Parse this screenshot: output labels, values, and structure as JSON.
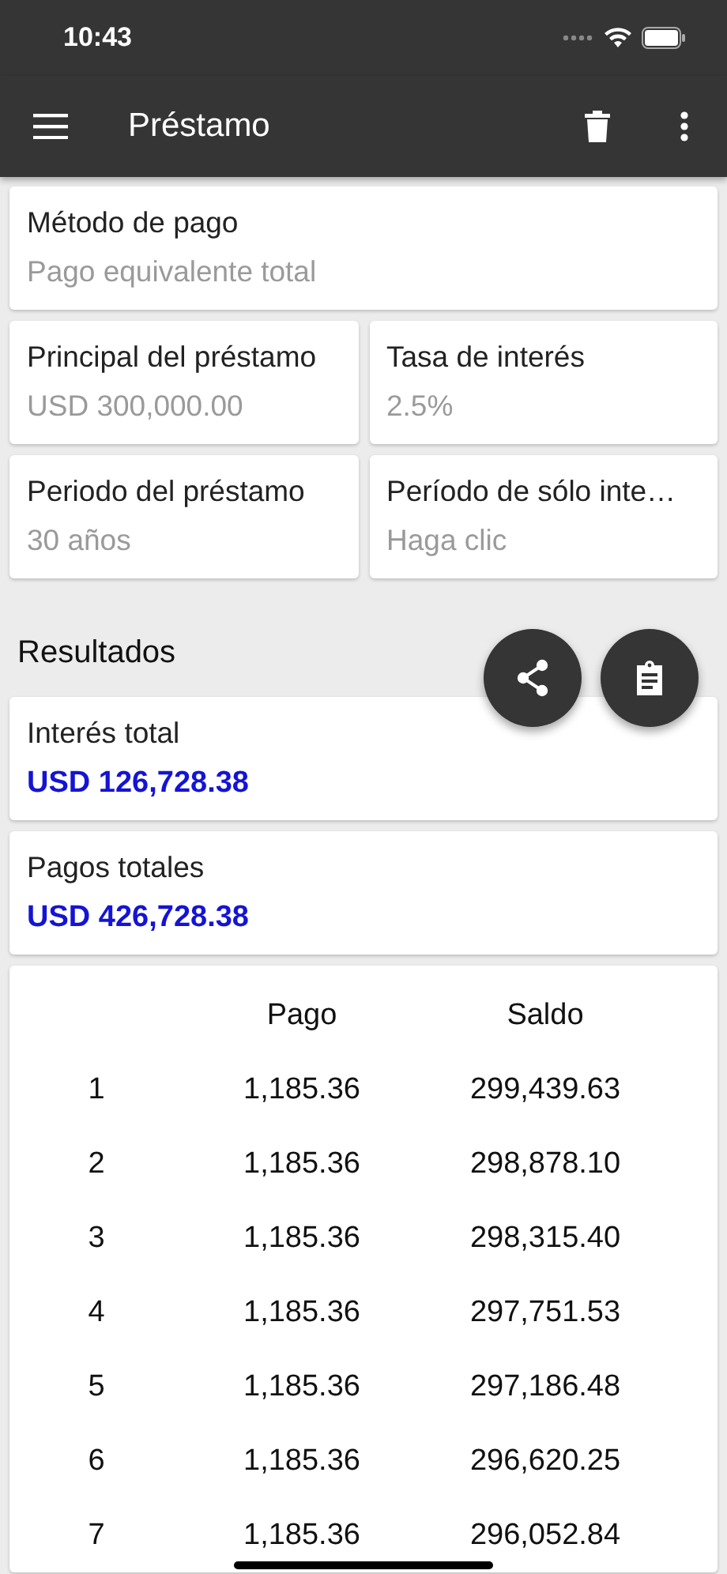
{
  "status_bar": {
    "time": "10:43"
  },
  "app_bar": {
    "title": "Préstamo"
  },
  "inputs": [
    {
      "label": "Método de pago",
      "value": "Pago equivalente total",
      "wide": true
    },
    {
      "label": "Principal del préstamo",
      "value": "USD 300,000.00",
      "wide": false
    },
    {
      "label": "Tasa de interés",
      "value": "2.5%",
      "wide": false
    },
    {
      "label": "Periodo del préstamo",
      "value": "30 años",
      "wide": false
    },
    {
      "label": "Período de sólo inte…",
      "value": "Haga clic",
      "wide": false
    }
  ],
  "results": {
    "title": "Resultados",
    "items": [
      {
        "label": "Interés total",
        "value": "USD 126,728.38"
      },
      {
        "label": "Pagos totales",
        "value": "USD 426,728.38"
      }
    ]
  },
  "table": {
    "columns": [
      "",
      "Pago",
      "Saldo"
    ],
    "rows": [
      [
        "1",
        "1,185.36",
        "299,439.63"
      ],
      [
        "2",
        "1,185.36",
        "298,878.10"
      ],
      [
        "3",
        "1,185.36",
        "298,315.40"
      ],
      [
        "4",
        "1,185.36",
        "297,751.53"
      ],
      [
        "5",
        "1,185.36",
        "297,186.48"
      ],
      [
        "6",
        "1,185.36",
        "296,620.25"
      ],
      [
        "7",
        "1,185.36",
        "296,052.84"
      ]
    ]
  }
}
